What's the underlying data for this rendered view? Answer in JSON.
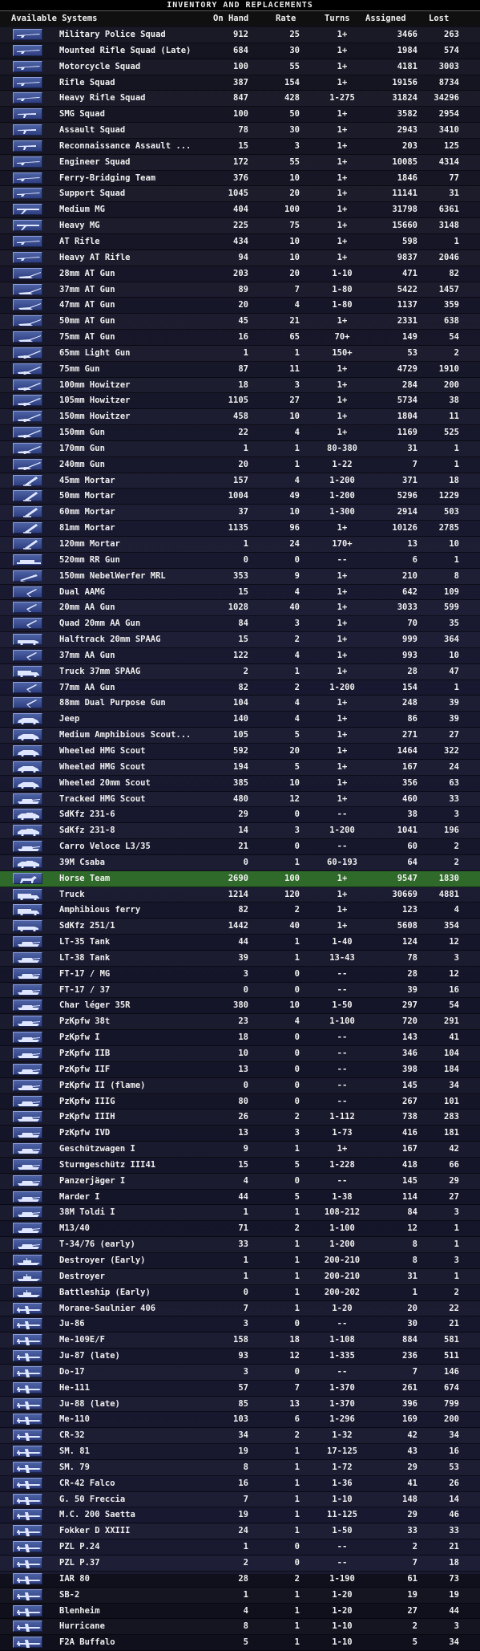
{
  "window": {
    "title": "INVENTORY AND REPLACEMENTS"
  },
  "columns": {
    "name": "Available Systems",
    "on_hand": "On Hand",
    "rate": "Rate",
    "turns": "Turns",
    "assigned": "Assigned",
    "lost": "Lost"
  },
  "rows": [
    {
      "n": "Military Police Squad",
      "h": "912",
      "r": "25",
      "t": "1+",
      "a": "3466",
      "l": "263",
      "i": "rifle-icon"
    },
    {
      "n": "Mounted Rifle Squad (Late)",
      "h": "684",
      "r": "30",
      "t": "1+",
      "a": "1984",
      "l": "574",
      "i": "rifle-icon"
    },
    {
      "n": "Motorcycle Squad",
      "h": "100",
      "r": "55",
      "t": "1+",
      "a": "4181",
      "l": "3003",
      "i": "rifle-icon"
    },
    {
      "n": "Rifle Squad",
      "h": "387",
      "r": "154",
      "t": "1+",
      "a": "19156",
      "l": "8734",
      "i": "rifle-icon"
    },
    {
      "n": "Heavy Rifle Squad",
      "h": "847",
      "r": "428",
      "t": "1-275",
      "a": "31824",
      "l": "34296",
      "i": "rifle-icon"
    },
    {
      "n": "SMG Squad",
      "h": "100",
      "r": "50",
      "t": "1+",
      "a": "3582",
      "l": "2954",
      "i": "smg-icon"
    },
    {
      "n": "Assault Squad",
      "h": "78",
      "r": "30",
      "t": "1+",
      "a": "2943",
      "l": "3410",
      "i": "smg-icon"
    },
    {
      "n": "Reconnaissance Assault ...",
      "h": "15",
      "r": "3",
      "t": "1+",
      "a": "203",
      "l": "125",
      "i": "smg-icon"
    },
    {
      "n": "Engineer Squad",
      "h": "172",
      "r": "55",
      "t": "1+",
      "a": "10085",
      "l": "4314",
      "i": "rifle-icon"
    },
    {
      "n": "Ferry-Bridging Team",
      "h": "376",
      "r": "10",
      "t": "1+",
      "a": "1846",
      "l": "77",
      "i": "rifle-icon"
    },
    {
      "n": "Support Squad",
      "h": "1045",
      "r": "20",
      "t": "1+",
      "a": "11141",
      "l": "31",
      "i": "rifle-icon"
    },
    {
      "n": "Medium MG",
      "h": "404",
      "r": "100",
      "t": "1+",
      "a": "31798",
      "l": "6361",
      "i": "mg-icon"
    },
    {
      "n": "Heavy MG",
      "h": "225",
      "r": "75",
      "t": "1+",
      "a": "15660",
      "l": "3148",
      "i": "mg-icon"
    },
    {
      "n": "AT Rifle",
      "h": "434",
      "r": "10",
      "t": "1+",
      "a": "598",
      "l": "1",
      "i": "rifle-icon"
    },
    {
      "n": "Heavy AT Rifle",
      "h": "94",
      "r": "10",
      "t": "1+",
      "a": "9837",
      "l": "2046",
      "i": "rifle-icon"
    },
    {
      "n": "28mm AT Gun",
      "h": "203",
      "r": "20",
      "t": "1-10",
      "a": "471",
      "l": "82",
      "i": "at-gun-icon"
    },
    {
      "n": "37mm AT Gun",
      "h": "89",
      "r": "7",
      "t": "1-80",
      "a": "5422",
      "l": "1457",
      "i": "at-gun-icon"
    },
    {
      "n": "47mm AT Gun",
      "h": "20",
      "r": "4",
      "t": "1-80",
      "a": "1137",
      "l": "359",
      "i": "at-gun-icon"
    },
    {
      "n": "50mm AT Gun",
      "h": "45",
      "r": "21",
      "t": "1+",
      "a": "2331",
      "l": "638",
      "i": "at-gun-icon"
    },
    {
      "n": "75mm AT Gun",
      "h": "16",
      "r": "65",
      "t": "70+",
      "a": "149",
      "l": "54",
      "i": "at-gun-icon"
    },
    {
      "n": "65mm Light Gun",
      "h": "1",
      "r": "1",
      "t": "150+",
      "a": "53",
      "l": "2",
      "i": "field-gun-icon"
    },
    {
      "n": "75mm Gun",
      "h": "87",
      "r": "11",
      "t": "1+",
      "a": "4729",
      "l": "1910",
      "i": "field-gun-icon"
    },
    {
      "n": "100mm Howitzer",
      "h": "18",
      "r": "3",
      "t": "1+",
      "a": "284",
      "l": "200",
      "i": "field-gun-icon"
    },
    {
      "n": "105mm Howitzer",
      "h": "1105",
      "r": "27",
      "t": "1+",
      "a": "5734",
      "l": "38",
      "i": "field-gun-icon"
    },
    {
      "n": "150mm Howitzer",
      "h": "458",
      "r": "10",
      "t": "1+",
      "a": "1804",
      "l": "11",
      "i": "field-gun-icon"
    },
    {
      "n": "150mm Gun",
      "h": "22",
      "r": "4",
      "t": "1+",
      "a": "1169",
      "l": "525",
      "i": "field-gun-icon"
    },
    {
      "n": "170mm Gun",
      "h": "1",
      "r": "1",
      "t": "80-380",
      "a": "31",
      "l": "1",
      "i": "field-gun-icon"
    },
    {
      "n": "240mm Gun",
      "h": "20",
      "r": "1",
      "t": "1-22",
      "a": "7",
      "l": "1",
      "i": "field-gun-icon"
    },
    {
      "n": "45mm Mortar",
      "h": "157",
      "r": "4",
      "t": "1-200",
      "a": "371",
      "l": "18",
      "i": "mortar-icon"
    },
    {
      "n": "50mm Mortar",
      "h": "1004",
      "r": "49",
      "t": "1-200",
      "a": "5296",
      "l": "1229",
      "i": "mortar-icon"
    },
    {
      "n": "60mm Mortar",
      "h": "37",
      "r": "10",
      "t": "1-300",
      "a": "2914",
      "l": "503",
      "i": "mortar-icon"
    },
    {
      "n": "81mm Mortar",
      "h": "1135",
      "r": "96",
      "t": "1+",
      "a": "10126",
      "l": "2785",
      "i": "mortar-icon"
    },
    {
      "n": "120mm Mortar",
      "h": "1",
      "r": "24",
      "t": "170+",
      "a": "13",
      "l": "10",
      "i": "mortar-icon"
    },
    {
      "n": "520mm RR Gun",
      "h": "0",
      "r": "0",
      "t": "--",
      "a": "6",
      "l": "1",
      "i": "rr-gun-icon"
    },
    {
      "n": "150mm NebelWerfer MRL",
      "h": "353",
      "r": "9",
      "t": "1+",
      "a": "210",
      "l": "8",
      "i": "rocket-icon"
    },
    {
      "n": "Dual AAMG",
      "h": "15",
      "r": "4",
      "t": "1+",
      "a": "642",
      "l": "109",
      "i": "aa-gun-icon"
    },
    {
      "n": "20mm AA Gun",
      "h": "1028",
      "r": "40",
      "t": "1+",
      "a": "3033",
      "l": "599",
      "i": "aa-gun-icon"
    },
    {
      "n": "Quad 20mm AA Gun",
      "h": "84",
      "r": "3",
      "t": "1+",
      "a": "70",
      "l": "35",
      "i": "aa-gun-icon"
    },
    {
      "n": "Halftrack 20mm SPAAG",
      "h": "15",
      "r": "2",
      "t": "1+",
      "a": "999",
      "l": "364",
      "i": "halftrack-icon"
    },
    {
      "n": "37mm AA Gun",
      "h": "122",
      "r": "4",
      "t": "1+",
      "a": "993",
      "l": "10",
      "i": "aa-gun-icon"
    },
    {
      "n": "Truck 37mm SPAAG",
      "h": "2",
      "r": "1",
      "t": "1+",
      "a": "28",
      "l": "47",
      "i": "truck-icon"
    },
    {
      "n": "77mm AA Gun",
      "h": "82",
      "r": "2",
      "t": "1-200",
      "a": "154",
      "l": "1",
      "i": "aa-gun-icon"
    },
    {
      "n": "88mm Dual Purpose Gun",
      "h": "104",
      "r": "4",
      "t": "1+",
      "a": "248",
      "l": "39",
      "i": "aa-gun-icon"
    },
    {
      "n": "Jeep",
      "h": "140",
      "r": "4",
      "t": "1+",
      "a": "86",
      "l": "39",
      "i": "car-icon"
    },
    {
      "n": "Medium Amphibious Scout...",
      "h": "105",
      "r": "5",
      "t": "1+",
      "a": "271",
      "l": "27",
      "i": "car-icon"
    },
    {
      "n": "Wheeled HMG Scout",
      "h": "592",
      "r": "20",
      "t": "1+",
      "a": "1464",
      "l": "322",
      "i": "car-icon"
    },
    {
      "n": "Wheeled HMG Scout",
      "h": "194",
      "r": "5",
      "t": "1+",
      "a": "167",
      "l": "24",
      "i": "car-icon"
    },
    {
      "n": "Wheeled 20mm Scout",
      "h": "385",
      "r": "10",
      "t": "1+",
      "a": "356",
      "l": "63",
      "i": "car-icon"
    },
    {
      "n": "Tracked HMG Scout",
      "h": "480",
      "r": "12",
      "t": "1+",
      "a": "460",
      "l": "33",
      "i": "tank-icon"
    },
    {
      "n": "SdKfz 231-6",
      "h": "29",
      "r": "0",
      "t": "--",
      "a": "38",
      "l": "3",
      "i": "armored-car-icon"
    },
    {
      "n": "SdKfz 231-8",
      "h": "14",
      "r": "3",
      "t": "1-200",
      "a": "1041",
      "l": "196",
      "i": "armored-car-icon"
    },
    {
      "n": "Carro Veloce L3/35",
      "h": "21",
      "r": "0",
      "t": "--",
      "a": "60",
      "l": "2",
      "i": "tank-icon"
    },
    {
      "n": "39M Csaba",
      "h": "0",
      "r": "1",
      "t": "60-193",
      "a": "64",
      "l": "2",
      "i": "armored-car-icon"
    },
    {
      "n": "Horse Team",
      "h": "2690",
      "r": "100",
      "t": "1+",
      "a": "9547",
      "l": "1830",
      "i": "horse-icon"
    },
    {
      "n": "Truck",
      "h": "1214",
      "r": "120",
      "t": "1+",
      "a": "30669",
      "l": "4881",
      "i": "truck-icon"
    },
    {
      "n": "Amphibious ferry",
      "h": "82",
      "r": "2",
      "t": "1+",
      "a": "123",
      "l": "4",
      "i": "truck-icon"
    },
    {
      "n": "SdKfz 251/1",
      "h": "1442",
      "r": "40",
      "t": "1+",
      "a": "5608",
      "l": "354",
      "i": "halftrack-icon"
    },
    {
      "n": "LT-35 Tank",
      "h": "44",
      "r": "1",
      "t": "1-40",
      "a": "124",
      "l": "12",
      "i": "tank-icon"
    },
    {
      "n": "LT-38 Tank",
      "h": "39",
      "r": "1",
      "t": "13-43",
      "a": "78",
      "l": "3",
      "i": "tank-icon"
    },
    {
      "n": "FT-17 / MG",
      "h": "3",
      "r": "0",
      "t": "--",
      "a": "28",
      "l": "12",
      "i": "tank-icon"
    },
    {
      "n": "FT-17 / 37",
      "h": "0",
      "r": "0",
      "t": "--",
      "a": "39",
      "l": "16",
      "i": "tank-icon"
    },
    {
      "n": "Char léger 35R",
      "h": "380",
      "r": "10",
      "t": "1-50",
      "a": "297",
      "l": "54",
      "i": "tank-icon"
    },
    {
      "n": "PzKpfw 38t",
      "h": "23",
      "r": "4",
      "t": "1-100",
      "a": "720",
      "l": "291",
      "i": "tank-icon"
    },
    {
      "n": "PzKpfw I",
      "h": "18",
      "r": "0",
      "t": "--",
      "a": "143",
      "l": "41",
      "i": "tank-icon"
    },
    {
      "n": "PzKpfw IIB",
      "h": "10",
      "r": "0",
      "t": "--",
      "a": "346",
      "l": "104",
      "i": "tank-icon"
    },
    {
      "n": "PzKpfw IIF",
      "h": "13",
      "r": "0",
      "t": "--",
      "a": "398",
      "l": "184",
      "i": "tank-icon"
    },
    {
      "n": "PzKpfw II (flame)",
      "h": "0",
      "r": "0",
      "t": "--",
      "a": "145",
      "l": "34",
      "i": "tank-icon"
    },
    {
      "n": "PzKpfw IIIG",
      "h": "80",
      "r": "0",
      "t": "--",
      "a": "267",
      "l": "101",
      "i": "tank-icon"
    },
    {
      "n": "PzKpfw IIIH",
      "h": "26",
      "r": "2",
      "t": "1-112",
      "a": "738",
      "l": "283",
      "i": "tank-icon"
    },
    {
      "n": "PzKpfw IVD",
      "h": "13",
      "r": "3",
      "t": "1-73",
      "a": "416",
      "l": "181",
      "i": "tank-icon"
    },
    {
      "n": "Geschützwagen I",
      "h": "9",
      "r": "1",
      "t": "1+",
      "a": "167",
      "l": "42",
      "i": "tank-icon"
    },
    {
      "n": "Sturmgeschütz III41",
      "h": "15",
      "r": "5",
      "t": "1-228",
      "a": "418",
      "l": "66",
      "i": "tank-icon"
    },
    {
      "n": "Panzerjäger I",
      "h": "4",
      "r": "0",
      "t": "--",
      "a": "145",
      "l": "29",
      "i": "tank-icon"
    },
    {
      "n": "Marder I",
      "h": "44",
      "r": "5",
      "t": "1-38",
      "a": "114",
      "l": "27",
      "i": "tank-icon"
    },
    {
      "n": "38M Toldi I",
      "h": "1",
      "r": "1",
      "t": "108-212",
      "a": "84",
      "l": "3",
      "i": "tank-icon"
    },
    {
      "n": "M13/40",
      "h": "71",
      "r": "2",
      "t": "1-100",
      "a": "12",
      "l": "1",
      "i": "tank-icon"
    },
    {
      "n": "T-34/76 (early)",
      "h": "33",
      "r": "1",
      "t": "1-200",
      "a": "8",
      "l": "1",
      "i": "tank-icon"
    },
    {
      "n": "Destroyer (Early)",
      "h": "1",
      "r": "1",
      "t": "200-210",
      "a": "8",
      "l": "3",
      "i": "ship-icon"
    },
    {
      "n": "Destroyer",
      "h": "1",
      "r": "1",
      "t": "200-210",
      "a": "31",
      "l": "1",
      "i": "ship-icon"
    },
    {
      "n": "Battleship (Early)",
      "h": "0",
      "r": "1",
      "t": "200-202",
      "a": "1",
      "l": "2",
      "i": "ship-icon"
    },
    {
      "n": "Morane-Saulnier 406",
      "h": "7",
      "r": "1",
      "t": "1-20",
      "a": "20",
      "l": "22",
      "i": "plane-icon"
    },
    {
      "n": "Ju-86",
      "h": "3",
      "r": "0",
      "t": "--",
      "a": "30",
      "l": "21",
      "i": "plane-icon"
    },
    {
      "n": "Me-109E/F",
      "h": "158",
      "r": "18",
      "t": "1-108",
      "a": "884",
      "l": "581",
      "i": "plane-icon"
    },
    {
      "n": "Ju-87 (late)",
      "h": "93",
      "r": "12",
      "t": "1-335",
      "a": "236",
      "l": "511",
      "i": "plane-icon"
    },
    {
      "n": "Do-17",
      "h": "3",
      "r": "0",
      "t": "--",
      "a": "7",
      "l": "146",
      "i": "plane-icon"
    },
    {
      "n": "He-111",
      "h": "57",
      "r": "7",
      "t": "1-370",
      "a": "261",
      "l": "674",
      "i": "plane-icon"
    },
    {
      "n": "Ju-88 (late)",
      "h": "85",
      "r": "13",
      "t": "1-370",
      "a": "396",
      "l": "799",
      "i": "plane-icon"
    },
    {
      "n": "Me-110",
      "h": "103",
      "r": "6",
      "t": "1-296",
      "a": "169",
      "l": "200",
      "i": "plane-icon"
    },
    {
      "n": "CR-32",
      "h": "34",
      "r": "2",
      "t": "1-32",
      "a": "42",
      "l": "34",
      "i": "plane-icon"
    },
    {
      "n": "SM. 81",
      "h": "19",
      "r": "1",
      "t": "17-125",
      "a": "43",
      "l": "16",
      "i": "plane-icon"
    },
    {
      "n": "SM. 79",
      "h": "8",
      "r": "1",
      "t": "1-72",
      "a": "29",
      "l": "53",
      "i": "plane-icon"
    },
    {
      "n": "CR-42 Falco",
      "h": "16",
      "r": "1",
      "t": "1-36",
      "a": "41",
      "l": "26",
      "i": "plane-icon"
    },
    {
      "n": "G. 50 Freccia",
      "h": "7",
      "r": "1",
      "t": "1-10",
      "a": "148",
      "l": "14",
      "i": "plane-icon"
    },
    {
      "n": "M.C. 200 Saetta",
      "h": "19",
      "r": "1",
      "t": "11-125",
      "a": "29",
      "l": "46",
      "i": "plane-icon"
    },
    {
      "n": "Fokker D XXIII",
      "h": "24",
      "r": "1",
      "t": "1-50",
      "a": "33",
      "l": "33",
      "i": "plane-icon"
    },
    {
      "n": "PZL P.24",
      "h": "1",
      "r": "0",
      "t": "--",
      "a": "2",
      "l": "21",
      "i": "plane-icon"
    },
    {
      "n": "PZL P.37",
      "h": "2",
      "r": "0",
      "t": "--",
      "a": "7",
      "l": "18",
      "i": "plane-icon"
    },
    {
      "n": "IAR 80",
      "h": "28",
      "r": "2",
      "t": "1-190",
      "a": "61",
      "l": "73",
      "i": "plane-icon"
    },
    {
      "n": "SB-2",
      "h": "1",
      "r": "1",
      "t": "1-20",
      "a": "19",
      "l": "19",
      "i": "plane-icon"
    },
    {
      "n": "Blenheim",
      "h": "4",
      "r": "1",
      "t": "1-20",
      "a": "27",
      "l": "44",
      "i": "plane-icon"
    },
    {
      "n": "Hurricane",
      "h": "8",
      "r": "1",
      "t": "1-10",
      "a": "2",
      "l": "3",
      "i": "plane-icon"
    },
    {
      "n": "F2A Buffalo",
      "h": "5",
      "r": "1",
      "t": "1-10",
      "a": "5",
      "l": "34",
      "i": "plane-icon"
    }
  ],
  "selected_row": 53,
  "colors": {
    "background": "#15152a",
    "selected_row": "#2f6a2a",
    "text": "#f0f0f0",
    "icon_bg": "#3a4c90"
  }
}
